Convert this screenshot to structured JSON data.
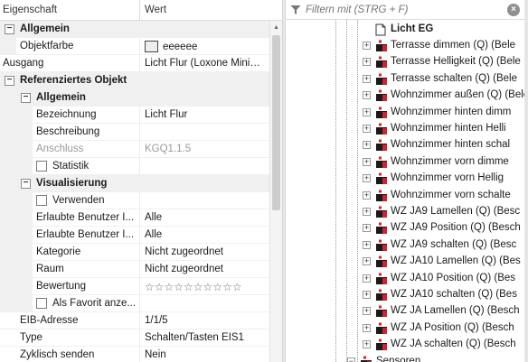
{
  "grid": {
    "col_property": "Eigenschaft",
    "col_value": "Wert",
    "rows": [
      {
        "label": "Allgemein",
        "value": ""
      },
      {
        "label": "Objektfarbe",
        "value": "eeeeee"
      },
      {
        "label": "Ausgang",
        "value": "Licht Flur (Loxone Mini…"
      },
      {
        "label": "Referenziertes Objekt",
        "value": ""
      },
      {
        "label": "Allgemein",
        "value": ""
      },
      {
        "label": "Bezeichnung",
        "value": "Licht Flur"
      },
      {
        "label": "Beschreibung",
        "value": ""
      },
      {
        "label": "Anschluss",
        "value": "KGQ1.1.5"
      },
      {
        "label": "Statistik",
        "value": ""
      },
      {
        "label": "Visualisierung",
        "value": ""
      },
      {
        "label": "Verwenden",
        "value": ""
      },
      {
        "label": "Erlaubte Benutzer I...",
        "value": "Alle"
      },
      {
        "label": "Erlaubte Benutzer I...",
        "value": "Alle"
      },
      {
        "label": "Kategorie",
        "value": "Nicht zugeordnet"
      },
      {
        "label": "Raum",
        "value": "Nicht zugeordnet"
      },
      {
        "label": "Bewertung",
        "value": "☆☆☆☆☆☆☆☆☆☆"
      },
      {
        "label": "Als Favorit anze...",
        "value": ""
      },
      {
        "label": "EIB-Adresse",
        "value": "1/1/5"
      },
      {
        "label": "Type",
        "value": "Schalten/Tasten EIS1"
      },
      {
        "label": "Zyklisch senden",
        "value": "Nein"
      }
    ]
  },
  "filter": {
    "placeholder": "Filtern mit (STRG + F)"
  },
  "tree": {
    "header_item": "Licht EG",
    "items": [
      "Terrasse dimmen (Q) (Bele",
      "Terrasse Helligkeit (Q) (Bele",
      "Terrasse schalten (Q) (Bele",
      "Wohnzimmer außen (Q) (Bele",
      "Wohnzimmer hinten dimm",
      "Wohnzimmer hinten Helli",
      "Wohnzimmer hinten schal",
      "Wohnzimmer vorn dimme",
      "Wohnzimmer vorn Hellig",
      "Wohnzimmer vorn schalte",
      "WZ JA9 Lamellen (Q) (Besc",
      "WZ JA9 Position (Q) (Besch",
      "WZ JA9 schalten (Q) (Besc",
      "WZ JA10 Lamellen (Q) (Bes",
      "WZ JA10 Position (Q) (Bes",
      "WZ JA10 schalten (Q) (Bes",
      "WZ JA Lamellen (Q) (Besch",
      "WZ JA Position (Q) (Besch",
      "WZ JA schalten (Q) (Besch"
    ],
    "footer_item": "Sensoren"
  },
  "colors": {
    "accent_red": "#d8202a",
    "category_bg": "#f0f0f0"
  }
}
